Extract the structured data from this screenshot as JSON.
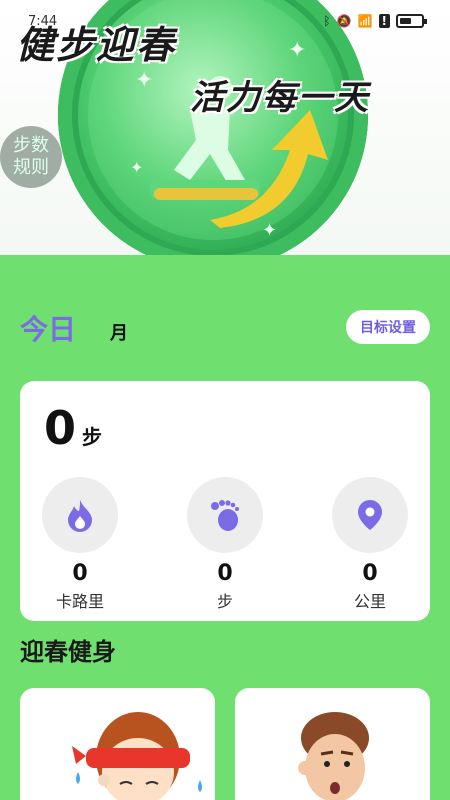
{
  "status_bar": {
    "time": "7:44"
  },
  "banner": {
    "title_line1": "健步迎春",
    "title_line2": "活力每一天"
  },
  "rules_button": {
    "label": "步数规则"
  },
  "tabs": [
    {
      "label": "今日",
      "active": true
    },
    {
      "label": "月",
      "active": false
    }
  ],
  "goal_button": {
    "label": "目标设置"
  },
  "summary": {
    "steps": "0",
    "steps_unit": "步"
  },
  "stats": [
    {
      "icon": "flame-icon",
      "value": "0",
      "label": "卡路里"
    },
    {
      "icon": "footprint-icon",
      "value": "0",
      "label": "步"
    },
    {
      "icon": "location-pin-icon",
      "value": "0",
      "label": "公里"
    }
  ],
  "section": {
    "title": "迎春健身"
  },
  "colors": {
    "background": "#6fe070",
    "accent": "#7b6ce6",
    "card": "#ffffff"
  }
}
